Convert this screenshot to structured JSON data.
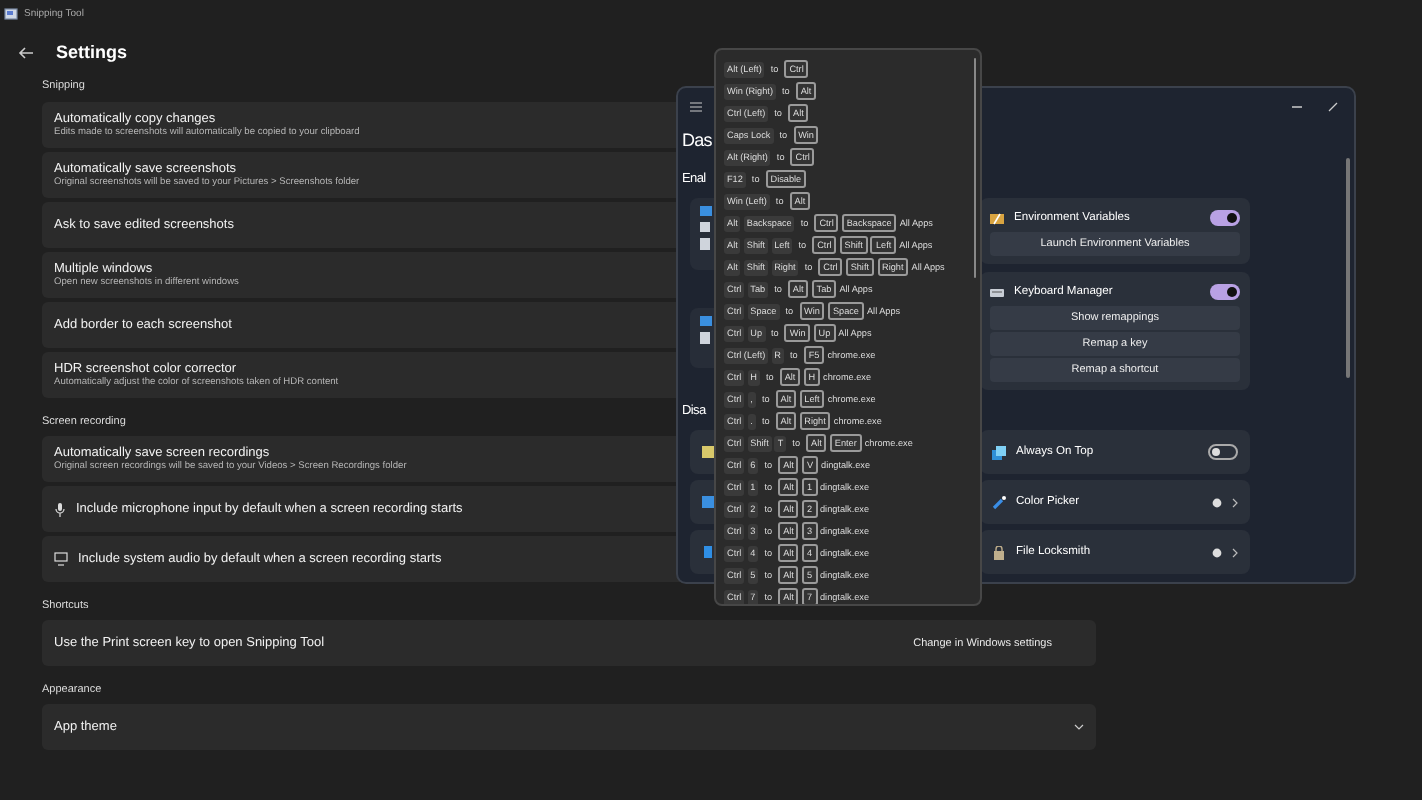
{
  "app": {
    "title": "Snipping Tool"
  },
  "settings": {
    "title": "Settings",
    "sections": [
      {
        "label": "Snipping",
        "rows": [
          {
            "kind": "setting",
            "title": "Automatically copy changes",
            "description": "Edits made to screenshots will automatically be copied to your clipboard"
          },
          {
            "kind": "setting",
            "title": "Automatically save screenshots",
            "description": "Original screenshots will be saved to your Pictures > Screenshots folder"
          },
          {
            "kind": "setting",
            "title": "Ask to save edited screenshots"
          },
          {
            "kind": "setting",
            "title": "Multiple windows",
            "description": "Open new screenshots in different windows"
          },
          {
            "kind": "setting",
            "title": "Add border to each screenshot"
          },
          {
            "kind": "setting",
            "title": "HDR screenshot color corrector",
            "description": "Automatically adjust the color of screenshots taken of HDR content"
          }
        ]
      },
      {
        "label": "Screen recording",
        "rows": [
          {
            "kind": "setting",
            "title": "Automatically save screen recordings",
            "description": "Original screen recordings will be saved to your Videos > Screen Recordings folder"
          },
          {
            "kind": "microphone",
            "title": "Include microphone input by default when a screen recording starts"
          },
          {
            "kind": "audio",
            "title": "Include system audio by default when a screen recording starts"
          }
        ]
      },
      {
        "label": "Shortcuts",
        "rows": [
          {
            "kind": "link",
            "title": "Use the Print screen key to open Snipping Tool",
            "link": "Change in Windows settings"
          }
        ]
      },
      {
        "label": "Appearance",
        "rows": [
          {
            "kind": "dropdown",
            "value": "App theme"
          }
        ]
      }
    ]
  },
  "powertoys": {
    "heading": "Das",
    "enabled_label": "Enal",
    "disabled_label": "Disa",
    "enabled_modules": [
      {
        "name": "Environment Variables",
        "on": true,
        "buttons": [
          "Launch Environment Variables"
        ]
      },
      {
        "name": "Keyboard Manager",
        "on": true,
        "buttons": [
          "Show remappings",
          "Remap a key",
          "Remap a shortcut"
        ]
      }
    ],
    "disabled_modules": [
      {
        "name": "Always On Top",
        "kind": "toggle",
        "on": false
      },
      {
        "name": "Color Picker",
        "kind": "shortcut"
      },
      {
        "name": "File Locksmith",
        "kind": "shortcut"
      }
    ]
  },
  "remappings": [
    {
      "from": [
        "Alt (Left)"
      ],
      "separator": "to",
      "to": [
        "Ctrl"
      ]
    },
    {
      "from": [
        "Win (Right)"
      ],
      "separator": "to",
      "to": [
        "Alt"
      ]
    },
    {
      "from": [
        "Ctrl (Left)"
      ],
      "separator": "to",
      "to": [
        "Alt"
      ]
    },
    {
      "from": [
        "Caps Lock"
      ],
      "separator": "to",
      "to": [
        "Win"
      ]
    },
    {
      "from": [
        "Alt (Right)"
      ],
      "separator": "to",
      "to": [
        "Ctrl"
      ]
    },
    {
      "from": [
        "F12"
      ],
      "separator": "to",
      "to": [
        "Disable"
      ]
    },
    {
      "from": [
        "Win (Left)"
      ],
      "separator": "to",
      "to": [
        "Alt"
      ]
    },
    {
      "from": [
        "Alt",
        "Backspace"
      ],
      "separator": "to",
      "to": [
        "Ctrl",
        "Backspace"
      ],
      "app": "All Apps"
    },
    {
      "from": [
        "Alt",
        "Shift",
        "Left"
      ],
      "separator": "to",
      "to": [
        "Ctrl",
        "Shift",
        "Left"
      ],
      "app": "All Apps"
    },
    {
      "from": [
        "Alt",
        "Shift",
        "Right"
      ],
      "separator": "to",
      "to": [
        "Ctrl",
        "Shift",
        "Right"
      ],
      "app": "All Apps"
    },
    {
      "from": [
        "Ctrl",
        "Tab"
      ],
      "separator": "to",
      "to": [
        "Alt",
        "Tab"
      ],
      "app": "All Apps"
    },
    {
      "from": [
        "Ctrl",
        "Space"
      ],
      "separator": "to",
      "to": [
        "Win",
        "Space"
      ],
      "app": "All Apps"
    },
    {
      "from": [
        "Ctrl",
        "Up"
      ],
      "separator": "to",
      "to": [
        "Win",
        "Up"
      ],
      "app": "All Apps"
    },
    {
      "from": [
        "Ctrl (Left)",
        "R"
      ],
      "separator": "to",
      "to": [
        "F5"
      ],
      "app": "chrome.exe"
    },
    {
      "from": [
        "Ctrl",
        "H"
      ],
      "separator": "to",
      "to": [
        "Alt",
        "H"
      ],
      "app": "chrome.exe"
    },
    {
      "from": [
        "Ctrl",
        ","
      ],
      "separator": "to",
      "to": [
        "Alt",
        "Left"
      ],
      "app": "chrome.exe"
    },
    {
      "from": [
        "Ctrl",
        "."
      ],
      "separator": "to",
      "to": [
        "Alt",
        "Right"
      ],
      "app": "chrome.exe"
    },
    {
      "from": [
        "Ctrl",
        "Shift",
        "T"
      ],
      "separator": "to",
      "to": [
        "Alt",
        "Enter"
      ],
      "app": "chrome.exe"
    },
    {
      "from": [
        "Ctrl",
        "6"
      ],
      "separator": "to",
      "to": [
        "Alt",
        "V"
      ],
      "app": "dingtalk.exe"
    },
    {
      "from": [
        "Ctrl",
        "1"
      ],
      "separator": "to",
      "to": [
        "Alt",
        "1"
      ],
      "app": "dingtalk.exe"
    },
    {
      "from": [
        "Ctrl",
        "2"
      ],
      "separator": "to",
      "to": [
        "Alt",
        "2"
      ],
      "app": "dingtalk.exe"
    },
    {
      "from": [
        "Ctrl",
        "3"
      ],
      "separator": "to",
      "to": [
        "Alt",
        "3"
      ],
      "app": "dingtalk.exe"
    },
    {
      "from": [
        "Ctrl",
        "4"
      ],
      "separator": "to",
      "to": [
        "Alt",
        "4"
      ],
      "app": "dingtalk.exe"
    },
    {
      "from": [
        "Ctrl",
        "5"
      ],
      "separator": "to",
      "to": [
        "Alt",
        "5"
      ],
      "app": "dingtalk.exe"
    },
    {
      "from": [
        "Ctrl",
        "7"
      ],
      "separator": "to",
      "to": [
        "Alt",
        "7"
      ],
      "app": "dingtalk.exe"
    }
  ]
}
